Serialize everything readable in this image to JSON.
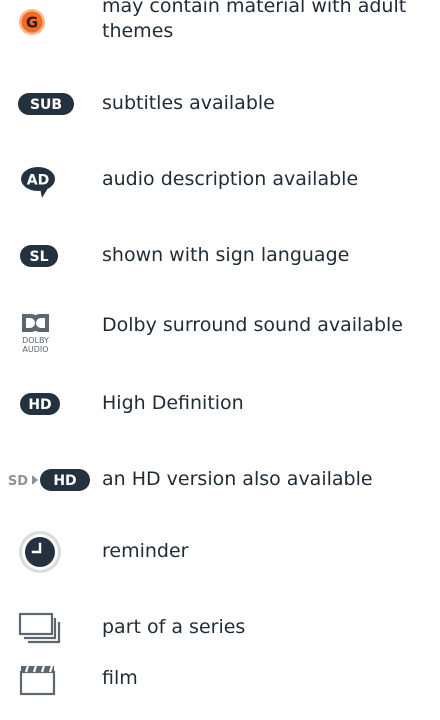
{
  "legend": {
    "items": [
      {
        "icon": "g-rating-icon",
        "glyph": "G",
        "label": "may contain material with adult themes"
      },
      {
        "icon": "subtitles-icon",
        "glyph": "SUB",
        "label": "subtitles available"
      },
      {
        "icon": "audio-description-icon",
        "glyph": "AD",
        "label": "audio description available"
      },
      {
        "icon": "sign-language-icon",
        "glyph": "SL",
        "label": "shown with sign language"
      },
      {
        "icon": "dolby-audio-icon",
        "glyph": "DOLBY AUDIO",
        "label": "Dolby surround sound available"
      },
      {
        "icon": "hd-icon",
        "glyph": "HD",
        "label": "High Definition"
      },
      {
        "icon": "sd-to-hd-icon",
        "glyph": "SD HD",
        "label": "an HD version also available"
      },
      {
        "icon": "reminder-clock-icon",
        "glyph": "",
        "label": "reminder"
      },
      {
        "icon": "series-stack-icon",
        "glyph": "",
        "label": "part of a series"
      },
      {
        "icon": "film-clapper-icon",
        "glyph": "",
        "label": "film"
      }
    ]
  },
  "colors": {
    "text": "#1f2b36",
    "badge": "#24323f",
    "g_orange": "#f26b21",
    "g_ring": "#ffb38a",
    "icon_grey": "#5d6770"
  }
}
